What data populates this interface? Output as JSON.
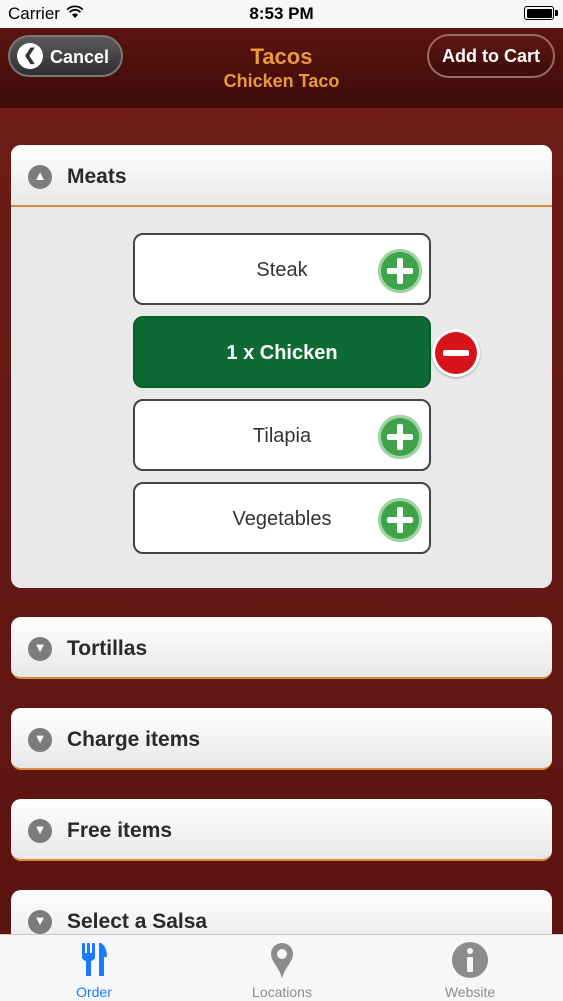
{
  "status_bar": {
    "carrier": "Carrier",
    "time": "8:53 PM"
  },
  "nav": {
    "cancel_label": "Cancel",
    "title": "Tacos",
    "subtitle": "Chicken Taco",
    "add_to_cart_label": "Add to Cart"
  },
  "meats": {
    "title": "Meats",
    "options": [
      {
        "label": "Steak",
        "selected": false
      },
      {
        "label": "1 x Chicken",
        "selected": true
      },
      {
        "label": "Tilapia",
        "selected": false
      },
      {
        "label": "Vegetables",
        "selected": false
      }
    ]
  },
  "sections": [
    {
      "title": "Tortillas"
    },
    {
      "title": "Charge items"
    },
    {
      "title": "Free items"
    },
    {
      "title": "Select a Salsa"
    }
  ],
  "tabs": [
    {
      "label": "Order",
      "icon": "fork-knife-icon",
      "active": true
    },
    {
      "label": "Locations",
      "icon": "map-pin-icon",
      "active": false
    },
    {
      "label": "Website",
      "icon": "info-icon",
      "active": false
    }
  ],
  "colors": {
    "accent": "#e89a3b",
    "selected_option": "#0c6b35",
    "add_green": "#3fa34a",
    "remove_red": "#d8141b",
    "tab_active": "#1a7bff"
  }
}
